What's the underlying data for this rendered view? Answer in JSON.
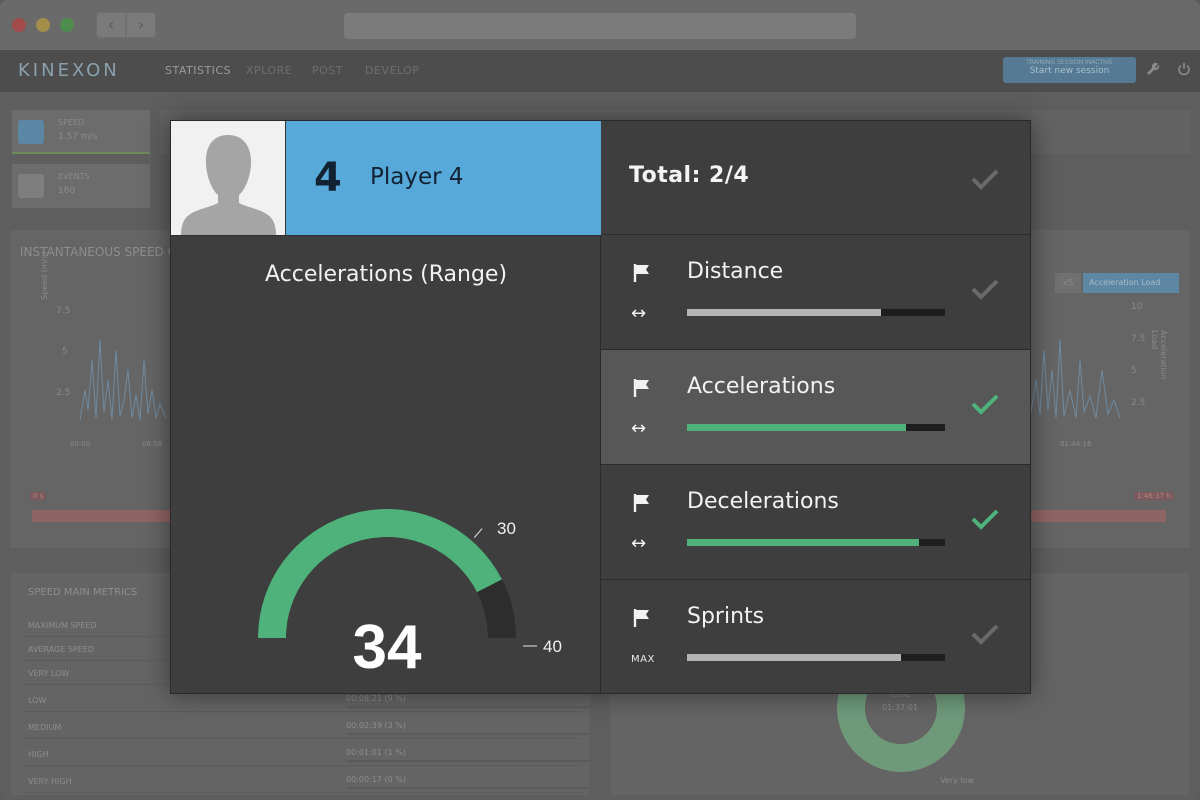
{
  "app": {
    "logo": "KINEXON",
    "nav": [
      "STATISTICS",
      "XPLORE",
      "POST",
      "DEVELOP"
    ],
    "session_small": "TRAINING SESSION INACTIVE",
    "session_button": "Start new session",
    "icons": [
      "wrench-icon",
      "power-icon"
    ]
  },
  "background": {
    "stats": [
      {
        "label": "SPEED",
        "value": "1.57 m/s",
        "icon": "gauge-icon"
      },
      {
        "label": "EVENTS",
        "value": "160",
        "icon": "tag-icon"
      }
    ],
    "chart_title": "INSTANTANEOUS SPEED O",
    "y_ticks_left": [
      "7.5",
      "5",
      "2.5"
    ],
    "y_label_left": "Speed (m/s)",
    "x_ticks": [
      "00:00",
      "06:58",
      "01:44:16"
    ],
    "y_ticks_right": [
      "10",
      "7.5",
      "5",
      "2.5"
    ],
    "y_label_right": "Acceleration Load",
    "vs_label": "VS",
    "select_value": "Acceleration Load",
    "range_start": "0 s",
    "range_end": "1:46:37 h",
    "metrics_title": "SPEED MAIN METRICS",
    "metrics": [
      {
        "label": "MAXIMUM SPEED",
        "value": ""
      },
      {
        "label": "AVERAGE SPEED",
        "value": ""
      },
      {
        "label": "VERY LOW",
        "value": ""
      },
      {
        "label": "LOW",
        "value": "00:08:21  (9 %)"
      },
      {
        "label": "MEDIUM",
        "value": "00:02:39  (3 %)"
      },
      {
        "label": "HIGH",
        "value": "00:01:01  (1 %)"
      },
      {
        "label": "VERY HIGH",
        "value": "00:00:17  (0 %)"
      }
    ],
    "donut_total_label": "TOTAL",
    "donut_total_value": "01:37:01",
    "donut_legend": "Very low"
  },
  "modal": {
    "player_number": "4",
    "player_name": "Player 4",
    "total": "Total: 2/4",
    "gauge_title": "Accelerations (Range)",
    "gauge": {
      "value": "34",
      "min_label": "30",
      "max_label": "40",
      "value_num": 34,
      "min": 30,
      "max": 40
    },
    "metrics": [
      {
        "name": "Distance",
        "sub": "arrow",
        "sub_label": "↔",
        "progress": 0.75,
        "color": "#b4b4b4",
        "achieved": false
      },
      {
        "name": "Accelerations",
        "sub": "arrow",
        "sub_label": "↔",
        "progress": 0.85,
        "color": "#4fb27b",
        "achieved": true,
        "highlight": true
      },
      {
        "name": "Decelerations",
        "sub": "arrow",
        "sub_label": "↔",
        "progress": 0.9,
        "color": "#4fb27b",
        "achieved": true
      },
      {
        "name": "Sprints",
        "sub": "max",
        "sub_label": "MAX",
        "progress": 0.83,
        "color": "#b4b4b4",
        "achieved": false
      }
    ],
    "colors": {
      "accent_blue": "#56a9d8",
      "green": "#4fb27b",
      "grey_check": "#6a6a6a"
    }
  }
}
